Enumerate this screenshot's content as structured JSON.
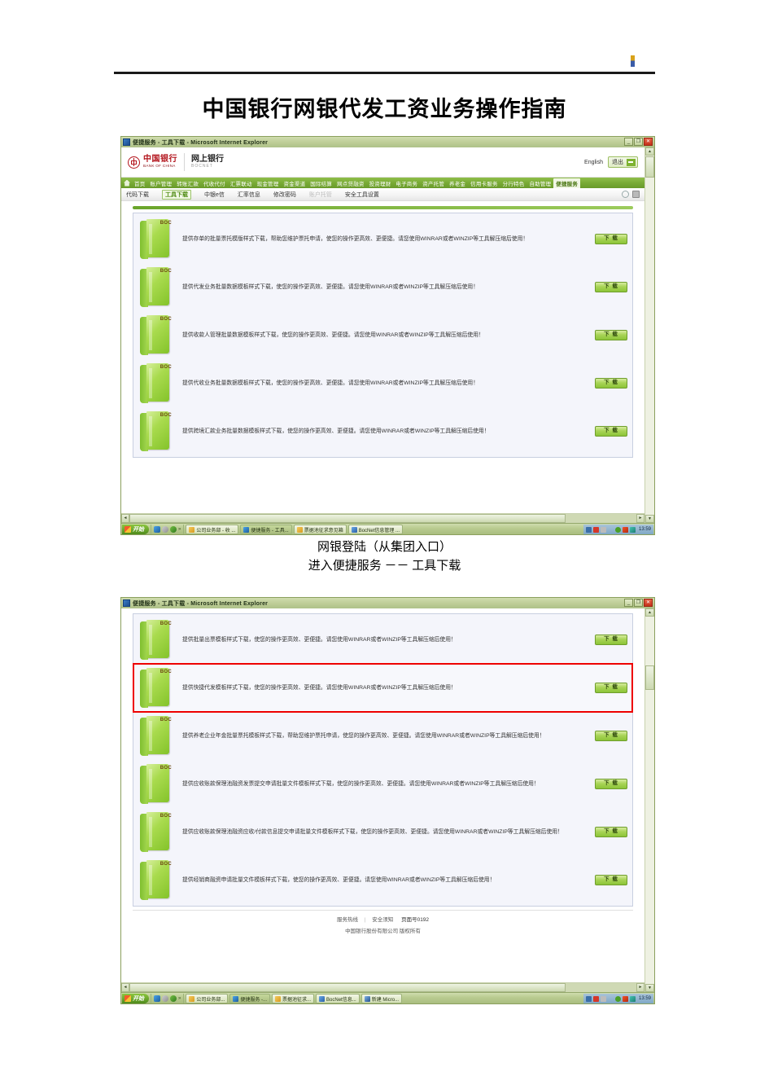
{
  "document": {
    "title": "中国银行网银代发工资业务操作指南",
    "caption_line1": "网银登陆（从集团入口）",
    "caption_line2": "进入便捷服务 －－ 工具下载"
  },
  "browser": {
    "title_bar": "便捷服务 - 工具下载 - Microsoft Internet Explorer",
    "minimize_label": "_",
    "restore_label": "❐",
    "close_label": "✕"
  },
  "site_header": {
    "bank_name_cn": "中国银行",
    "bank_name_en": "BANK OF CHINA",
    "product_cn": "网上银行",
    "product_en": "BOCNET",
    "language_link": "English",
    "logout_label": "退出"
  },
  "nav_main": {
    "items": [
      {
        "label": "首页",
        "active": false
      },
      {
        "label": "账户管理",
        "active": false
      },
      {
        "label": "转账汇款",
        "active": false
      },
      {
        "label": "代收代付",
        "active": false
      },
      {
        "label": "汇票联动",
        "active": false
      },
      {
        "label": "现金管理",
        "active": false
      },
      {
        "label": "资金渠道",
        "active": false
      },
      {
        "label": "国际结算",
        "active": false
      },
      {
        "label": "网点贷融资",
        "active": false
      },
      {
        "label": "投资理财",
        "active": false
      },
      {
        "label": "电子商务",
        "active": false
      },
      {
        "label": "资产托管",
        "active": false
      },
      {
        "label": "养老金",
        "active": false
      },
      {
        "label": "信用卡服务",
        "active": false
      },
      {
        "label": "分行特色",
        "active": false
      },
      {
        "label": "自助管理",
        "active": false
      },
      {
        "label": "便捷服务",
        "active": true
      }
    ]
  },
  "nav_sub": {
    "items": [
      {
        "label": "代码下载",
        "state": "normal"
      },
      {
        "label": "工具下载",
        "state": "active"
      },
      {
        "label": "中银e信",
        "state": "normal"
      },
      {
        "label": "汇率信息",
        "state": "normal"
      },
      {
        "label": "修改密码",
        "state": "normal"
      },
      {
        "label": "账户托管",
        "state": "disabled"
      },
      {
        "label": "安全工具设置",
        "state": "normal"
      }
    ]
  },
  "screenshot_one": {
    "download_label": "下 载",
    "rows": [
      {
        "icon_label": "BOC",
        "desc": "提供存单的批量票托模版样式下载，帮助您维护票托申请，使您的操作更高效、更便捷。请您使用WINRAR或者WINZIP等工具解压缩后使用！"
      },
      {
        "icon_label": "BOC",
        "desc": "提供代发业务批量数据模板样式下载，使您的操作更高效、更便捷。请您使用WINRAR或者WINZIP等工具解压缩后使用！"
      },
      {
        "icon_label": "BOC",
        "desc": "提供收款人管理批量数据模板样式下载，使您的操作更高效、更便捷。请您使用WINRAR或者WINZIP等工具解压缩后使用！"
      },
      {
        "icon_label": "BOC",
        "desc": "提供代收业务批量数据模板样式下载，使您的操作更高效、更便捷。请您使用WINRAR或者WINZIP等工具解压缩后使用！"
      },
      {
        "icon_label": "BOC",
        "desc": "提供跨境汇款业务批量数据模板样式下载，使您的操作更高效、更便捷。请您使用WINRAR或者WINZIP等工具解压缩后使用！"
      }
    ]
  },
  "screenshot_two": {
    "download_label": "下 载",
    "rows": [
      {
        "icon_label": "BOC",
        "highlighted": false,
        "desc": "提供批量出票模板样式下载，使您的操作更高效、更便捷。请您使用WINRAR或者WINZIP等工具解压缩后使用！"
      },
      {
        "icon_label": "BOC",
        "highlighted": true,
        "desc": "提供快捷代发模板样式下载，使您的操作更高效、更便捷。请您使用WINRAR或者WINZIP等工具解压缩后使用！"
      },
      {
        "icon_label": "BOC",
        "highlighted": false,
        "desc": "提供养老企业年金批量票托模板样式下载，帮助您维护票托申请，使您的操作更高效、更便捷。请您使用WINRAR或者WINZIP等工具解压缩后使用！"
      },
      {
        "icon_label": "BOC",
        "highlighted": false,
        "desc": "提供应收账款保理池融资发票提交申请批量文件模板样式下载，使您的操作更高效、更便捷。请您使用WINRAR或者WINZIP等工具解压缩后使用！"
      },
      {
        "icon_label": "BOC",
        "highlighted": false,
        "desc": "提供应收账款保理池融资应收/付款信息提交申请批量文件模板样式下载，使您的操作更高效、更便捷。请您使用WINRAR或者WINZIP等工具解压缩后使用！"
      },
      {
        "icon_label": "BOC",
        "highlighted": false,
        "desc": "提供经销商融资申请批量文件模板样式下载，使您的操作更高效、更便捷。请您使用WINRAR或者WINZIP等工具解压缩后使用！"
      }
    ],
    "footer": {
      "service_hotline": "服务热线",
      "security_notice": "安全须知",
      "page_number": "页面号0192",
      "copyright": "中国银行股份有限公司 版权所有"
    }
  },
  "taskbar_one": {
    "start_label": "开始",
    "quick_chevron": "»",
    "tasks": [
      {
        "label": "公司业务部 - 收 ...",
        "icon": "fold",
        "active": false
      },
      {
        "label": "便捷服务 - 工具...",
        "icon": "ie",
        "active": true
      },
      {
        "label": "票据池征求意见箱",
        "icon": "fold",
        "active": false
      },
      {
        "label": "BocNet信息管理 ...",
        "icon": "doc",
        "active": false
      }
    ],
    "clock": "13:59"
  },
  "taskbar_two": {
    "start_label": "开始",
    "quick_chevron": "»",
    "tasks": [
      {
        "label": "公司业务部...",
        "icon": "fold",
        "active": false
      },
      {
        "label": "便捷服务 -...",
        "icon": "ie",
        "active": true
      },
      {
        "label": "票据池征求...",
        "icon": "fold",
        "active": false
      },
      {
        "label": "BocNet信息...",
        "icon": "doc",
        "active": false
      },
      {
        "label": "新建 Micro...",
        "icon": "wd",
        "active": false
      }
    ],
    "clock": "13:59"
  },
  "colors": {
    "brand_red": "#b3141c",
    "nav_green": "#79ab36",
    "highlight_red": "#ee0000",
    "panel_bg": "#f4f5fb"
  }
}
